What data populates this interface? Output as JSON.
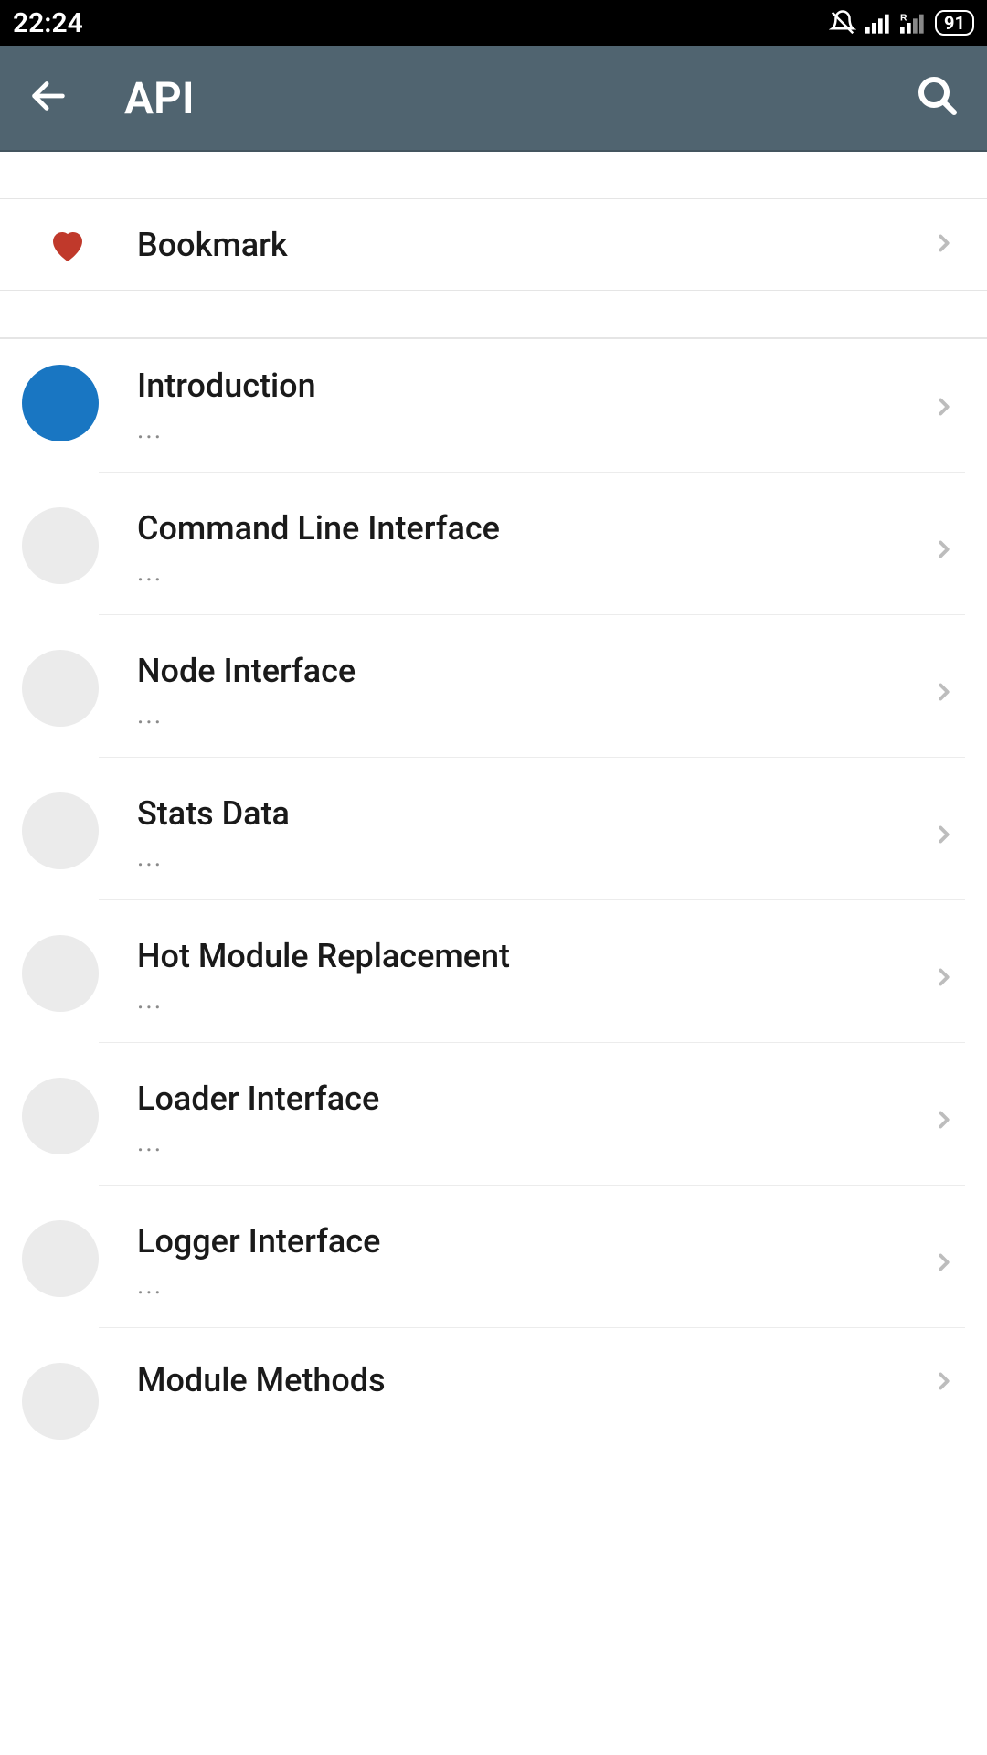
{
  "status": {
    "time": "22:24",
    "battery": "91"
  },
  "appbar": {
    "title": "API"
  },
  "bookmark": {
    "label": "Bookmark"
  },
  "items": [
    {
      "title": "Introduction",
      "subtitle": "...",
      "active": true
    },
    {
      "title": "Command Line Interface",
      "subtitle": "...",
      "active": false
    },
    {
      "title": "Node Interface",
      "subtitle": "...",
      "active": false
    },
    {
      "title": "Stats Data",
      "subtitle": "...",
      "active": false
    },
    {
      "title": "Hot Module Replacement",
      "subtitle": "...",
      "active": false
    },
    {
      "title": "Loader Interface",
      "subtitle": "...",
      "active": false
    },
    {
      "title": "Logger Interface",
      "subtitle": "...",
      "active": false
    },
    {
      "title": "Module Methods",
      "subtitle": "",
      "active": false
    }
  ]
}
